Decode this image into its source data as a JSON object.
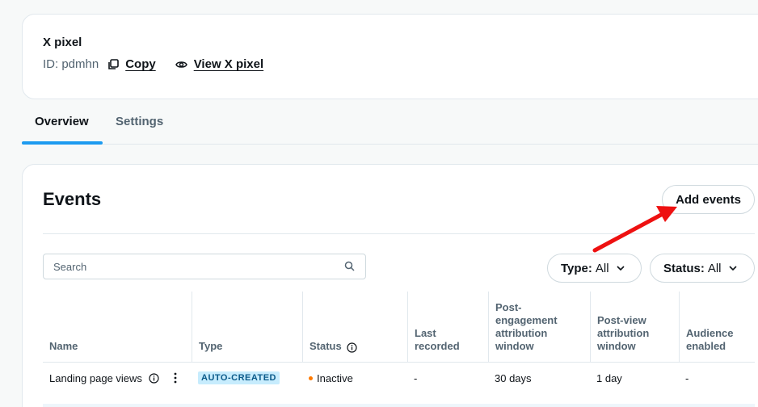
{
  "pixel": {
    "title": "X pixel",
    "id_label": "ID: pdmhn",
    "copy_label": "Copy",
    "view_label": "View X pixel"
  },
  "tabs": [
    {
      "label": "Overview",
      "active": true
    },
    {
      "label": "Settings",
      "active": false
    }
  ],
  "events": {
    "title": "Events",
    "add_label": "Add events",
    "search_placeholder": "Search",
    "filters": {
      "type_key": "Type:",
      "type_value": "All",
      "status_key": "Status:",
      "status_value": "All"
    },
    "columns": [
      "Name",
      "Type",
      "Status",
      "Last recorded",
      "Post-engagement attribution window",
      "Post-view attribution window",
      "Audience enabled"
    ],
    "rows": [
      {
        "name": "Landing page views",
        "type": "AUTO-CREATED",
        "status": "Inactive",
        "last_recorded": "-",
        "post_engagement": "30 days",
        "post_view": "1 day",
        "audience": "-"
      }
    ]
  },
  "colors": {
    "accent": "#1d9bf0",
    "badge_bg": "#c7ecfd",
    "inactive_dot": "#ff7a00",
    "annotation_arrow": "#ee1111"
  },
  "icons": [
    "copy-icon",
    "eye-icon",
    "search-icon",
    "chevron-down-icon",
    "info-icon",
    "more-vertical-icon"
  ]
}
